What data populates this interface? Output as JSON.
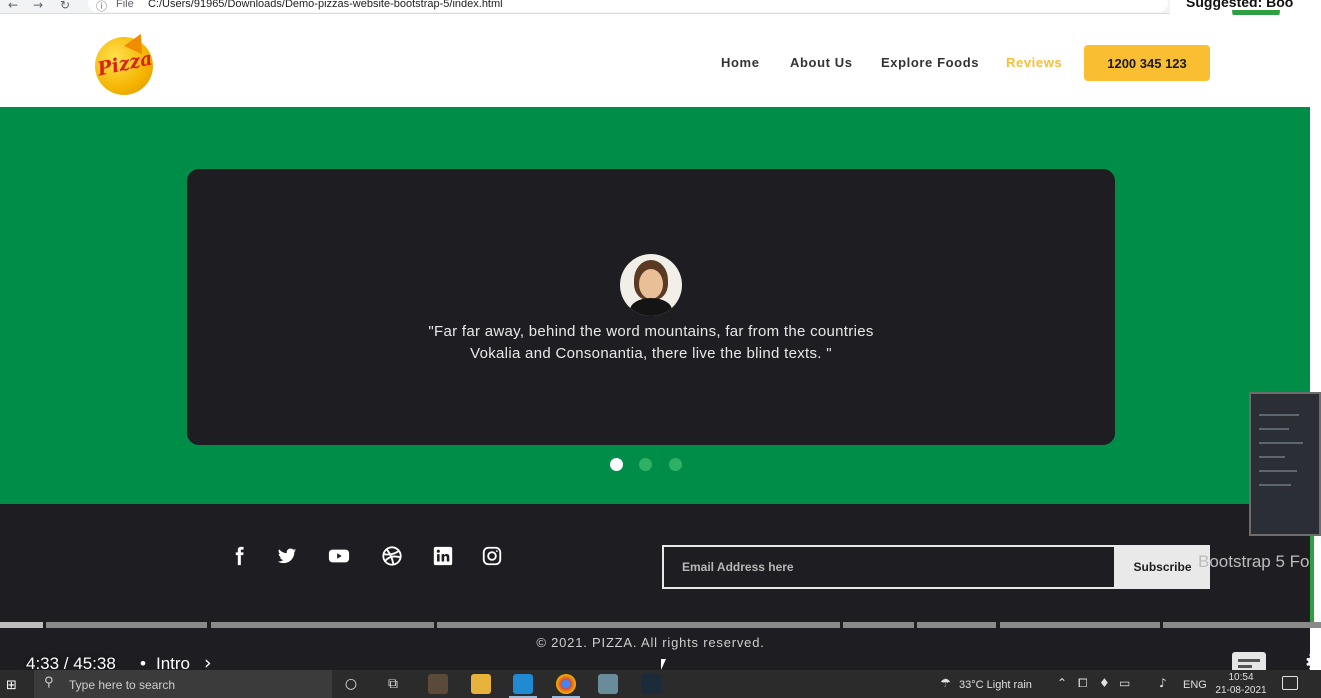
{
  "browser": {
    "back_icon": "arrow-left-icon",
    "forward_icon": "arrow-right-icon",
    "reload_icon": "reload-icon",
    "info_icon": "info-icon",
    "url_scheme": "File",
    "url_path": "C:/Users/91965/Downloads/Demo-pizzas-website-bootstrap-5/index.html"
  },
  "overlay_top_right": "Suggested: Boo",
  "header": {
    "logo_text": "Pizza",
    "nav": [
      "Home",
      "About Us",
      "Explore Foods",
      "Reviews"
    ],
    "active_nav": "Reviews",
    "phone_button": "1200 345 123"
  },
  "testimonial": {
    "quote_line1": "\"Far far away, behind the word mountains, far from the countries",
    "quote_line2": "Vokalia and Consonantia, there live the blind texts. \"",
    "dots": 3,
    "active_dot": 1
  },
  "footer": {
    "social_icons": [
      "facebook-icon",
      "twitter-icon",
      "youtube-icon",
      "dribbble-icon",
      "linkedin-icon",
      "instagram-icon"
    ],
    "email_placeholder": "Email Address here",
    "subscribe_label": "Subscribe",
    "copyright": "© 2021. PIZZA. All rights reserved."
  },
  "video_player": {
    "time": "4:33 / 45:38",
    "separator": "•",
    "chapter": "Intro",
    "sidebar_title": "Bootstrap 5 Fo"
  },
  "taskbar": {
    "search_placeholder": "Type here to search",
    "weather": "33°C  Light rain",
    "language": "ENG",
    "time": "10:54",
    "date": "21-08-2021"
  },
  "colors": {
    "brand_green": "#008d47",
    "accent_yellow": "#f9be32",
    "dark": "#1e1d22"
  }
}
